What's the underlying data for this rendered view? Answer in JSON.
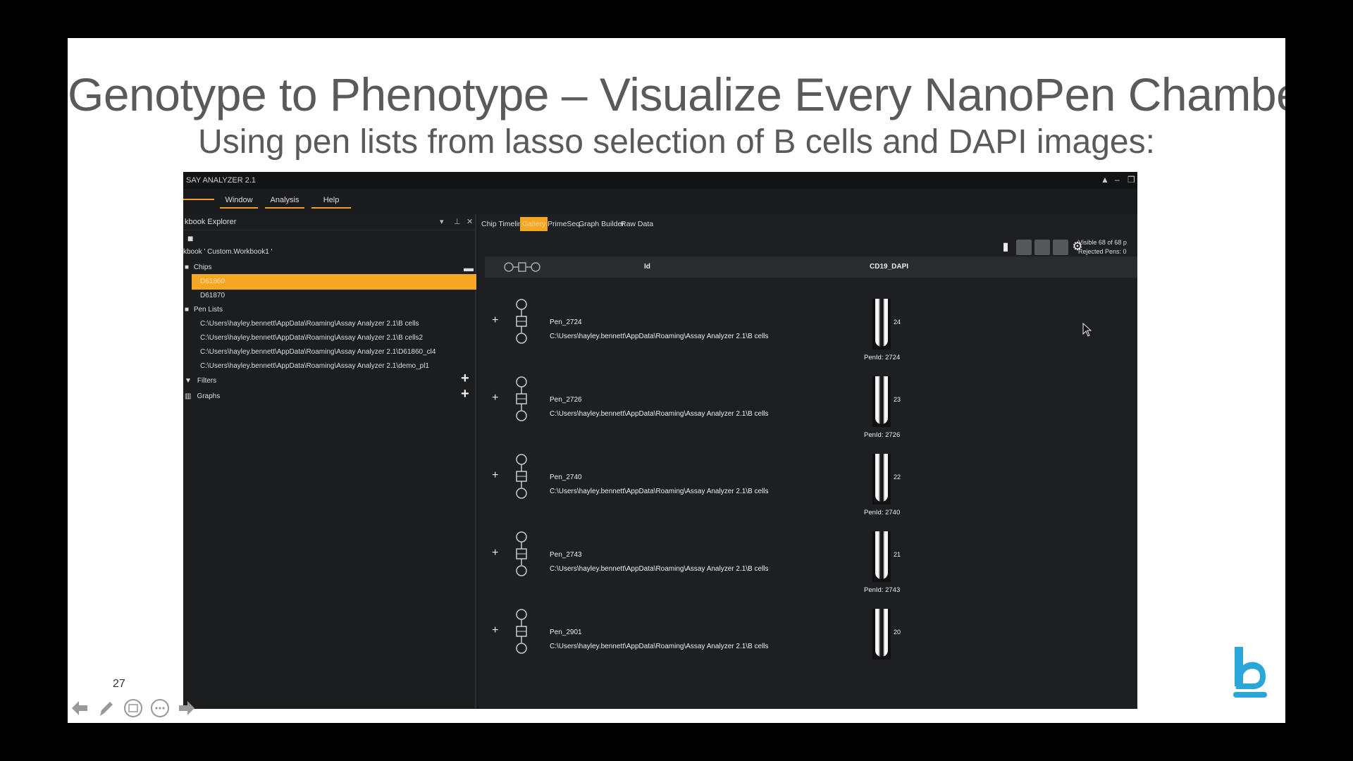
{
  "slide": {
    "title": "Genotype to Phenotype – Visualize Every NanoPen Chamber",
    "subtitle": "Using pen lists from lasso selection of B cells and DAPI images:",
    "page_number": "27"
  },
  "app": {
    "title": "SAY ANALYZER 2.1",
    "menu": [
      "Window",
      "Analysis",
      "Help"
    ],
    "explorer": {
      "title": "kbook Explorer",
      "workbook_label": "kbook ' Custom.Workbook1 '",
      "chips_label": "Chips",
      "chips": [
        "D61860",
        "D61870"
      ],
      "pen_lists_label": "Pen Lists",
      "pen_lists": [
        "C:\\Users\\hayley.bennett\\AppData\\Roaming\\Assay Analyzer 2.1\\B cells",
        "C:\\Users\\hayley.bennett\\AppData\\Roaming\\Assay Analyzer 2.1\\B cells2",
        "C:\\Users\\hayley.bennett\\AppData\\Roaming\\Assay Analyzer 2.1\\D61860_cl4",
        "C:\\Users\\hayley.bennett\\AppData\\Roaming\\Assay Analyzer 2.1\\demo_pl1"
      ],
      "filters_label": "Filters",
      "graphs_label": "Graphs"
    },
    "tabs": [
      "Chip Timeline",
      "Gallery",
      "PrimeSeq",
      "Graph Builder",
      "Raw Data"
    ],
    "active_tab": "Gallery",
    "visible_line1": "Visible 68 of 68 p",
    "visible_line2": "Rejected Pens: 0",
    "columns": {
      "id": "Id",
      "image": "CD19_DAPI"
    },
    "rows": [
      {
        "name": "Pen_2724",
        "path": "C:\\Users\\hayley.bennett\\AppData\\Roaming\\Assay Analyzer 2.1\\B cells",
        "number": "24",
        "pen_id": "PenId: 2724"
      },
      {
        "name": "Pen_2726",
        "path": "C:\\Users\\hayley.bennett\\AppData\\Roaming\\Assay Analyzer 2.1\\B cells",
        "number": "23",
        "pen_id": "PenId: 2726"
      },
      {
        "name": "Pen_2740",
        "path": "C:\\Users\\hayley.bennett\\AppData\\Roaming\\Assay Analyzer 2.1\\B cells",
        "number": "22",
        "pen_id": "PenId: 2740"
      },
      {
        "name": "Pen_2743",
        "path": "C:\\Users\\hayley.bennett\\AppData\\Roaming\\Assay Analyzer 2.1\\B cells",
        "number": "21",
        "pen_id": "PenId: 2743"
      },
      {
        "name": "Pen_2901",
        "path": "C:\\Users\\hayley.bennett\\AppData\\Roaming\\Assay Analyzer 2.1\\B cells",
        "number": "20",
        "pen_id": ""
      }
    ],
    "colors": {
      "accent": "#f5a623",
      "background": "#1a1b1d"
    }
  }
}
